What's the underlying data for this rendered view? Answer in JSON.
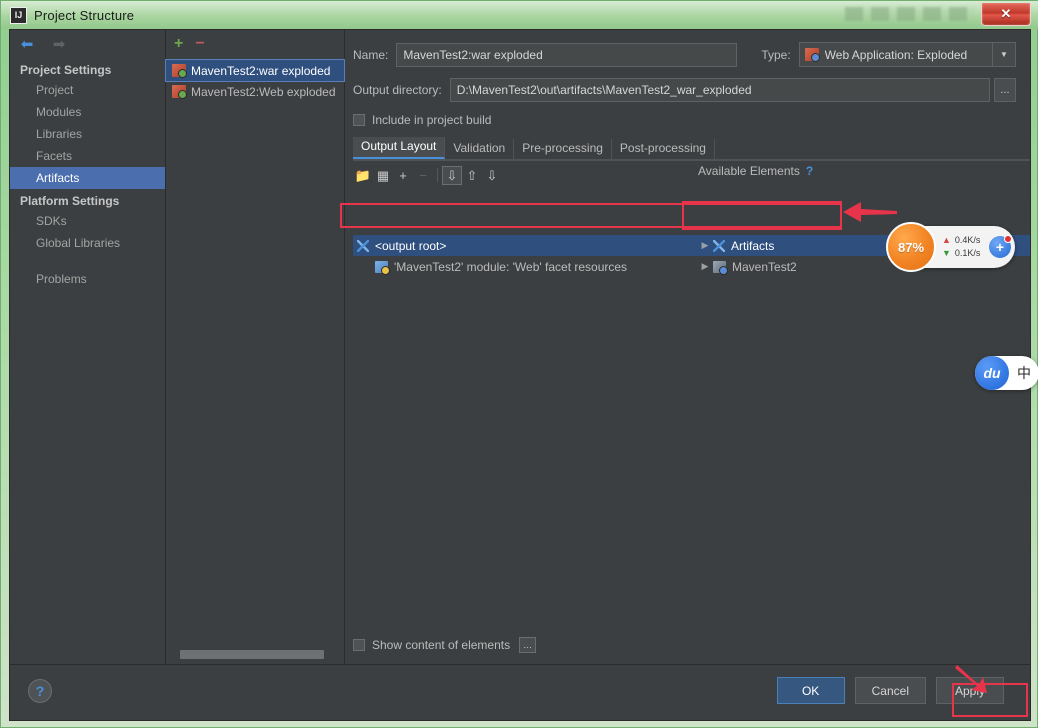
{
  "window": {
    "title": "Project Structure",
    "app_icon": "intellij-idea-icon",
    "close_label": "✕"
  },
  "sidebar": {
    "back_icon": "arrow-left-icon",
    "forward_icon": "arrow-right-icon",
    "groups": [
      {
        "title": "Project Settings",
        "items": [
          {
            "label": "Project",
            "selected": false
          },
          {
            "label": "Modules",
            "selected": false
          },
          {
            "label": "Libraries",
            "selected": false
          },
          {
            "label": "Facets",
            "selected": false
          },
          {
            "label": "Artifacts",
            "selected": true
          }
        ]
      },
      {
        "title": "Platform Settings",
        "items": [
          {
            "label": "SDKs",
            "selected": false
          },
          {
            "label": "Global Libraries",
            "selected": false
          }
        ]
      }
    ],
    "problems_label": "Problems"
  },
  "artifact_panel": {
    "add_icon": "plus-icon",
    "remove_icon": "minus-icon",
    "items": [
      {
        "label": "MavenTest2:war exploded",
        "selected": true
      },
      {
        "label": "MavenTest2:Web exploded",
        "selected": false
      }
    ]
  },
  "form": {
    "name_label": "Name:",
    "name_value": "MavenTest2:war exploded",
    "type_label": "Type:",
    "type_value": "Web Application: Exploded",
    "type_icon": "artifact-type-icon",
    "type_arrow_icon": "chevron-down-icon",
    "output_label": "Output directory:",
    "output_value": "D:\\MavenTest2\\out\\artifacts\\MavenTest2_war_exploded",
    "browse_label": "...",
    "include_checkbox_label": "Include in project build",
    "include_checked": false
  },
  "tabs": [
    {
      "label": "Output Layout",
      "active": true
    },
    {
      "label": "Validation",
      "active": false
    },
    {
      "label": "Pre-processing",
      "active": false
    },
    {
      "label": "Post-processing",
      "active": false
    }
  ],
  "panel_toolbar": {
    "icons": [
      {
        "name": "create-directory-icon",
        "glyph": "📁",
        "disabled": false
      },
      {
        "name": "create-archive-icon",
        "glyph": "▒",
        "disabled": false
      },
      {
        "name": "add-element-icon",
        "glyph": "+",
        "disabled": false
      },
      {
        "name": "remove-element-icon",
        "glyph": "−",
        "disabled": true
      },
      {
        "name": "sort-icon",
        "glyph": "↓≡",
        "disabled": false
      },
      {
        "name": "move-up-icon",
        "glyph": "↑",
        "disabled": false
      },
      {
        "name": "move-down-icon",
        "glyph": "↓",
        "disabled": false
      }
    ]
  },
  "output_tree": {
    "rows": [
      {
        "label": "<output root>",
        "icon": "artifact-root-icon",
        "indent": 0,
        "selected": true
      },
      {
        "label": "'MavenTest2' module: 'Web' facet resources",
        "icon": "module-facet-icon",
        "indent": 1,
        "selected": false
      }
    ]
  },
  "available_elements": {
    "title": "Available Elements",
    "help_icon": "help-question-icon",
    "rows": [
      {
        "label": "Artifacts",
        "icon": "artifacts-icon",
        "expander": "▶",
        "selected": true
      },
      {
        "label": "MavenTest2",
        "icon": "module-icon",
        "expander": "▶",
        "selected": false
      }
    ]
  },
  "bottom": {
    "show_content_label": "Show content of elements",
    "show_content_checked": false,
    "show_content_button": "…"
  },
  "footer": {
    "help_label": "?",
    "buttons": [
      {
        "label": "OK",
        "primary": true,
        "name": "ok-button"
      },
      {
        "label": "Cancel",
        "primary": false,
        "name": "cancel-button"
      },
      {
        "label": "Apply",
        "primary": false,
        "name": "apply-button"
      }
    ]
  },
  "overlays": {
    "netspeed": {
      "cpu_percent": "87%",
      "upload": "0.4K/s",
      "download": "0.1K/s",
      "up_icon": "arrow-up-icon",
      "down_icon": "arrow-down-icon",
      "plus_icon": "plus-circle-icon"
    },
    "ime": {
      "logo_text": "du",
      "mode_text": "中"
    }
  },
  "colors": {
    "accent": "#4a90d9",
    "selection": "#4b6eaf",
    "annotation": "#e8344a",
    "background": "#3c3f41",
    "primary_button": "#365880"
  }
}
